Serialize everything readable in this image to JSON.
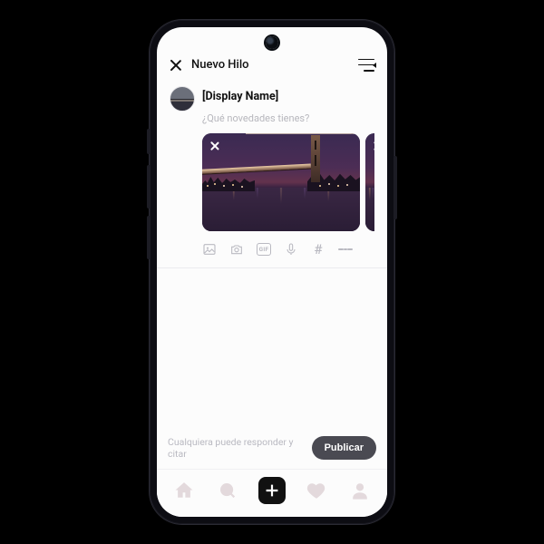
{
  "header": {
    "title": "Nuevo Hilo"
  },
  "composer": {
    "display_name": "[Display Name]",
    "placeholder": "¿Qué novedades tienes?"
  },
  "attachments": {
    "count": 2,
    "icons": {
      "gallery": "image-icon",
      "camera": "camera-icon",
      "gif": "GIF",
      "mic": "mic-icon",
      "hash": "#",
      "list": "list-icon"
    }
  },
  "footer": {
    "reply_scope": "Cualquiera puede responder y citar",
    "publish_label": "Publicar"
  },
  "tabs": {
    "home": "home-icon",
    "search": "search-icon",
    "new": "plus-icon",
    "activity": "heart-icon",
    "profile": "person-icon"
  }
}
